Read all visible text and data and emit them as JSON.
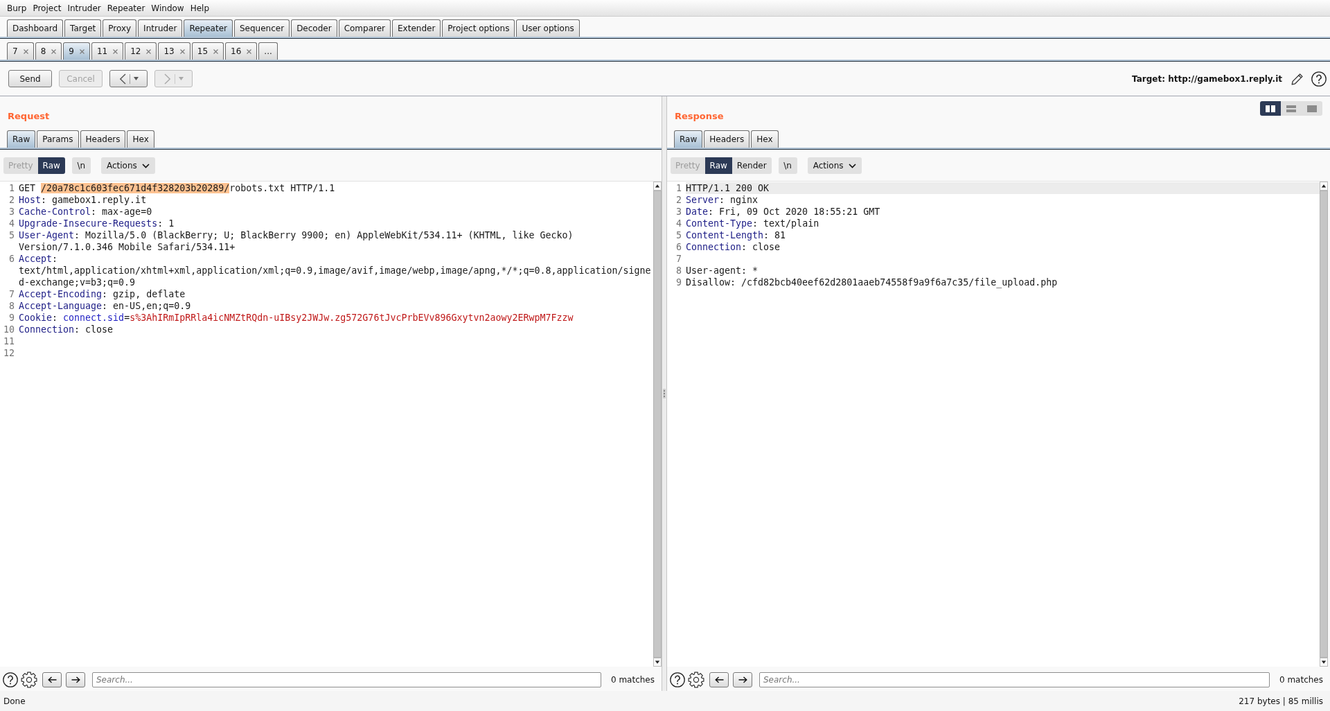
{
  "menu_bar": [
    "Burp",
    "Project",
    "Intruder",
    "Repeater",
    "Window",
    "Help"
  ],
  "main_tabs": [
    {
      "label": "Dashboard",
      "selected": false
    },
    {
      "label": "Target",
      "selected": false
    },
    {
      "label": "Proxy",
      "selected": false
    },
    {
      "label": "Intruder",
      "selected": false
    },
    {
      "label": "Repeater",
      "selected": true
    },
    {
      "label": "Sequencer",
      "selected": false
    },
    {
      "label": "Decoder",
      "selected": false
    },
    {
      "label": "Comparer",
      "selected": false
    },
    {
      "label": "Extender",
      "selected": false
    },
    {
      "label": "Project options",
      "selected": false
    },
    {
      "label": "User options",
      "selected": false
    }
  ],
  "repeater_tabs": [
    {
      "label": "7",
      "selected": false
    },
    {
      "label": "8",
      "selected": false
    },
    {
      "label": "9",
      "selected": true
    },
    {
      "label": "11",
      "selected": false
    },
    {
      "label": "12",
      "selected": false
    },
    {
      "label": "13",
      "selected": false
    },
    {
      "label": "15",
      "selected": false
    },
    {
      "label": "16",
      "selected": false
    }
  ],
  "repeater_overflow_tab": {
    "label": "..."
  },
  "toolbar": {
    "send": {
      "label": "Send",
      "disabled": false
    },
    "cancel": {
      "label": "Cancel",
      "disabled": true
    },
    "history_back": {
      "disabled": false
    },
    "history_forward": {
      "disabled": true
    },
    "target": "Target: http://gamebox1.reply.it"
  },
  "layout_buttons": [
    {
      "selected": true
    },
    {
      "selected": false
    },
    {
      "selected": false
    }
  ],
  "request": {
    "title": "Request",
    "tabs": [
      {
        "label": "Raw",
        "selected": true
      },
      {
        "label": "Params",
        "selected": false
      },
      {
        "label": "Headers",
        "selected": false
      },
      {
        "label": "Hex",
        "selected": false
      }
    ],
    "view_modes": [
      {
        "label": "Pretty",
        "selected": false,
        "disabled": true
      },
      {
        "label": "Raw",
        "selected": true,
        "disabled": false
      }
    ],
    "newline_button": "\\n",
    "actions": "Actions",
    "editor": {
      "lines": [
        {
          "number": "1",
          "current": false,
          "tokens": [
            {
              "kind": "plain",
              "text": "GET "
            },
            {
              "kind": "highlight",
              "text": "/20a78c1c603fec671d4f328203b20289/"
            },
            {
              "kind": "plain",
              "text": "robots.txt HTTP/1.1"
            }
          ]
        },
        {
          "number": "2",
          "current": false,
          "tokens": [
            {
              "kind": "header",
              "text": "Host"
            },
            {
              "kind": "plain",
              "text": ": gamebox1.reply.it"
            }
          ]
        },
        {
          "number": "3",
          "current": false,
          "tokens": [
            {
              "kind": "header",
              "text": "Cache-Control"
            },
            {
              "kind": "plain",
              "text": ": max-age=0"
            }
          ]
        },
        {
          "number": "4",
          "current": false,
          "tokens": [
            {
              "kind": "header",
              "text": "Upgrade-Insecure-Requests"
            },
            {
              "kind": "plain",
              "text": ": 1"
            }
          ]
        },
        {
          "number": "5",
          "current": false,
          "tokens": [
            {
              "kind": "header",
              "text": "User-Agent"
            },
            {
              "kind": "plain",
              "text": ": Mozilla/5.0 (BlackBerry; U; BlackBerry 9900; en) AppleWebKit/534.11+ (KHTML, like Gecko) Version/7.1.0.346 Mobile Safari/534.11+"
            }
          ]
        },
        {
          "number": "6",
          "current": false,
          "tokens": [
            {
              "kind": "header",
              "text": "Accept"
            },
            {
              "kind": "plain",
              "text": ": text/html,application/xhtml+xml,application/xml;q=0.9,image/avif,image/webp,image/apng,*/*;q=0.8,application/signed-exchange;v=b3;q=0.9"
            }
          ]
        },
        {
          "number": "7",
          "current": false,
          "tokens": [
            {
              "kind": "header",
              "text": "Accept-Encoding"
            },
            {
              "kind": "plain",
              "text": ": gzip, deflate"
            }
          ]
        },
        {
          "number": "8",
          "current": false,
          "tokens": [
            {
              "kind": "header",
              "text": "Accept-Language"
            },
            {
              "kind": "plain",
              "text": ": en-US,en;q=0.9"
            }
          ]
        },
        {
          "number": "9",
          "current": false,
          "tokens": [
            {
              "kind": "header",
              "text": "Cookie"
            },
            {
              "kind": "plain",
              "text": ": "
            },
            {
              "kind": "param_name",
              "text": "connect.sid"
            },
            {
              "kind": "plain",
              "text": "="
            },
            {
              "kind": "param_value",
              "text": "s%3AhIRmIpRRla4icNMZtRQdn-uIBsy2JWJw.zg572G76tJvcPrbEVv896Gxytvn2aowy2ERwpM7Fzzw"
            }
          ]
        },
        {
          "number": "10",
          "current": false,
          "tokens": [
            {
              "kind": "header",
              "text": "Connection"
            },
            {
              "kind": "plain",
              "text": ": close"
            }
          ]
        },
        {
          "number": "11",
          "current": false
        },
        {
          "number": "12",
          "current": false
        }
      ]
    },
    "search": {
      "placeholder": "Search...",
      "matches": "0 matches"
    }
  },
  "response": {
    "title": "Response",
    "tabs": [
      {
        "label": "Raw",
        "selected": true
      },
      {
        "label": "Headers",
        "selected": false
      },
      {
        "label": "Hex",
        "selected": false
      }
    ],
    "view_modes": [
      {
        "label": "Pretty",
        "selected": false,
        "disabled": true
      },
      {
        "label": "Raw",
        "selected": true,
        "disabled": false
      },
      {
        "label": "Render",
        "selected": false,
        "disabled": false
      }
    ],
    "newline_button": "\\n",
    "actions": "Actions",
    "editor": {
      "lines": [
        {
          "number": "1",
          "current": true,
          "tokens": [
            {
              "kind": "plain",
              "text": "HTTP/1.1 200 OK"
            }
          ]
        },
        {
          "number": "2",
          "current": false,
          "tokens": [
            {
              "kind": "header",
              "text": "Server"
            },
            {
              "kind": "plain",
              "text": ": nginx"
            }
          ]
        },
        {
          "number": "3",
          "current": false,
          "tokens": [
            {
              "kind": "header",
              "text": "Date"
            },
            {
              "kind": "plain",
              "text": ": Fri, 09 Oct 2020 18:55:21 GMT"
            }
          ]
        },
        {
          "number": "4",
          "current": false,
          "tokens": [
            {
              "kind": "header",
              "text": "Content-Type"
            },
            {
              "kind": "plain",
              "text": ": text/plain"
            }
          ]
        },
        {
          "number": "5",
          "current": false,
          "tokens": [
            {
              "kind": "header",
              "text": "Content-Length"
            },
            {
              "kind": "plain",
              "text": ": 81"
            }
          ]
        },
        {
          "number": "6",
          "current": false,
          "tokens": [
            {
              "kind": "header",
              "text": "Connection"
            },
            {
              "kind": "plain",
              "text": ": close"
            }
          ]
        },
        {
          "number": "7",
          "current": false
        },
        {
          "number": "8",
          "current": false,
          "tokens": [
            {
              "kind": "plain",
              "text": "User-agent: *"
            }
          ]
        },
        {
          "number": "9",
          "current": false,
          "tokens": [
            {
              "kind": "plain",
              "text": "Disallow: /cfd82bcb40eef62d2801aaeb74558f9a9f6a7c35/file_upload.php"
            }
          ]
        }
      ]
    },
    "search": {
      "placeholder": "Search...",
      "matches": "0 matches"
    }
  },
  "status_bar": {
    "message": "Done",
    "stats": "217 bytes | 85 millis"
  }
}
